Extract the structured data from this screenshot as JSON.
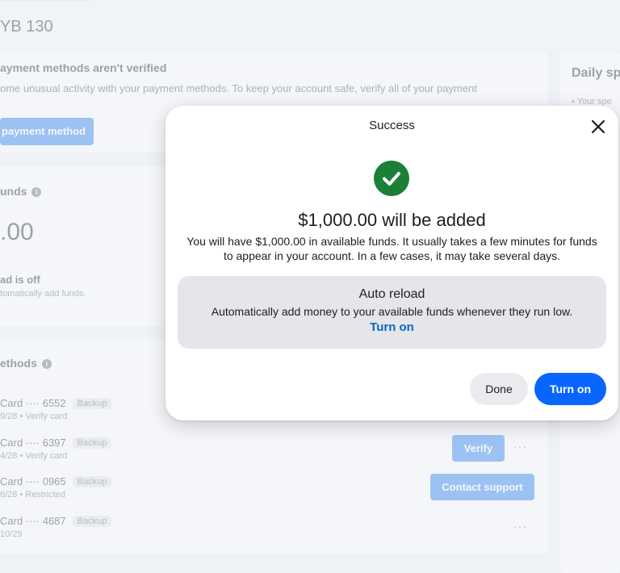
{
  "page": {
    "account_title": "YB 130"
  },
  "warning": {
    "title": "ayment methods aren't verified",
    "text": "ome unusual activity with your payment methods. To keep your account safe, verify all of your payment",
    "button": "payment method"
  },
  "funds": {
    "title": "unds",
    "amount": ".00",
    "auto_reload_title": "ad is off",
    "auto_reload_sub": "tomatically add funds."
  },
  "methods": {
    "title": "ethods",
    "items": [
      {
        "name": "Card ···· 6552",
        "badge": "Backup",
        "sub": "9/28 • Verify card"
      },
      {
        "name": "Card ···· 6397",
        "badge": "Backup",
        "sub": "4/28 • Verify card",
        "action": "Verify",
        "more": "···"
      },
      {
        "name": "Card ···· 0965",
        "badge": "Backup",
        "sub": "6/28 • Restricted",
        "action": "Contact support"
      },
      {
        "name": "Card ···· 4687",
        "badge": "Backup",
        "sub": "10/29",
        "more": "···"
      }
    ]
  },
  "daily": {
    "title": "Daily sp",
    "sub": "• Your spe"
  },
  "modal": {
    "title": "Success",
    "headline": "$1,000.00 will be added",
    "description": "You will have $1,000.00 in available funds. It usually takes a few minutes for funds to appear in your account. In a few cases, it may take several days.",
    "auto_reload": {
      "title": "Auto reload",
      "text": "Automatically add money to your available funds whenever they run low.",
      "link": "Turn on"
    },
    "done_button": "Done",
    "turn_on_button": "Turn on",
    "icons": {
      "close": "close-icon",
      "success": "check-circle-icon"
    },
    "colors": {
      "primary": "#0866ff",
      "success": "#1b7f37",
      "link": "#0a66c2"
    }
  }
}
